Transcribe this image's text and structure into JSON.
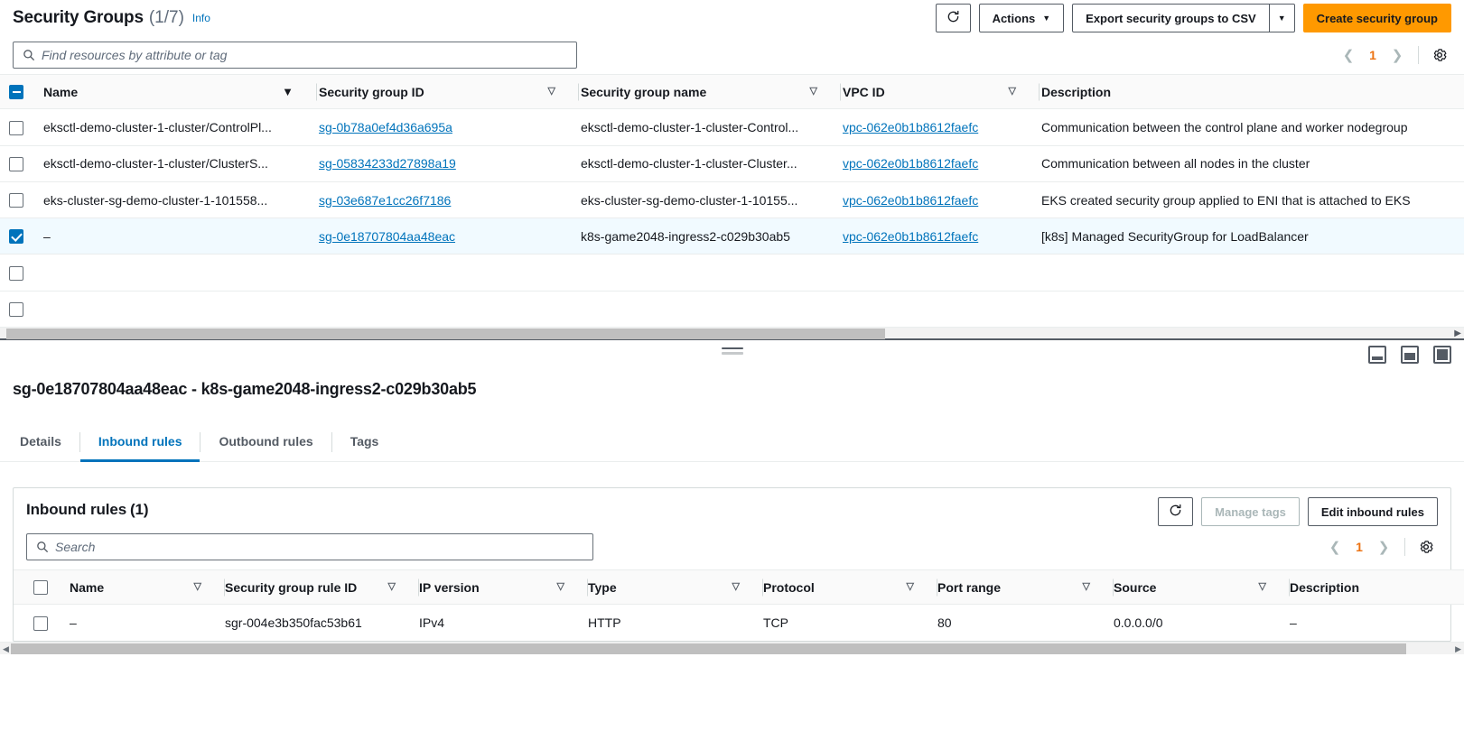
{
  "header": {
    "title": "Security Groups",
    "count": "(1/7)",
    "info_label": "Info",
    "refresh_icon": "refresh-icon",
    "actions_label": "Actions",
    "export_label": "Export security groups to CSV",
    "export_caret_icon": "chevron-down-icon",
    "create_label": "Create security group"
  },
  "search": {
    "placeholder": "Find resources by attribute or tag",
    "value": "",
    "icon": "search-icon"
  },
  "pagination": {
    "prev_icon": "chevron-left-icon",
    "page": "1",
    "next_icon": "chevron-right-icon",
    "settings_icon": "gear-icon"
  },
  "table": {
    "columns": [
      {
        "label": "Name",
        "sort_icon": "sort-descending-icon",
        "active": true
      },
      {
        "label": "Security group ID",
        "sort_icon": "sort-icon",
        "active": false
      },
      {
        "label": "Security group name",
        "sort_icon": "sort-icon",
        "active": false
      },
      {
        "label": "VPC ID",
        "sort_icon": "sort-icon",
        "active": false
      },
      {
        "label": "Description",
        "sort_icon": "",
        "active": false
      }
    ],
    "rows": [
      {
        "selected": false,
        "name": "eksctl-demo-cluster-1-cluster/ControlPl...",
        "sg_id": "sg-0b78a0ef4d36a695a",
        "sg_name": "eksctl-demo-cluster-1-cluster-Control...",
        "vpc_id": "vpc-062e0b1b8612faefc",
        "description": "Communication between the control plane and worker nodegroup"
      },
      {
        "selected": false,
        "name": "eksctl-demo-cluster-1-cluster/ClusterS...",
        "sg_id": "sg-05834233d27898a19",
        "sg_name": "eksctl-demo-cluster-1-cluster-Cluster...",
        "vpc_id": "vpc-062e0b1b8612faefc",
        "description": "Communication between all nodes in the cluster"
      },
      {
        "selected": false,
        "name": "eks-cluster-sg-demo-cluster-1-101558...",
        "sg_id": "sg-03e687e1cc26f7186",
        "sg_name": "eks-cluster-sg-demo-cluster-1-10155...",
        "vpc_id": "vpc-062e0b1b8612faefc",
        "description": "EKS created security group applied to ENI that is attached to EKS"
      },
      {
        "selected": true,
        "name": "–",
        "sg_id": "sg-0e18707804aa48eac",
        "sg_name": "k8s-game2048-ingress2-c029b30ab5",
        "vpc_id": "vpc-062e0b1b8612faefc",
        "description": "[k8s] Managed SecurityGroup for LoadBalancer"
      },
      {
        "selected": false,
        "name": "",
        "sg_id": "",
        "sg_name": "",
        "vpc_id": "",
        "description": ""
      },
      {
        "selected": false,
        "name": "",
        "sg_id": "",
        "sg_name": "",
        "vpc_id": "",
        "description": ""
      }
    ]
  },
  "split_panel": {
    "drag_handle_icon": "drag-handle-icon",
    "size_icons": [
      "panel-size-small-icon",
      "panel-size-medium-icon",
      "panel-size-large-icon"
    ],
    "title": "sg-0e18707804aa48eac - k8s-game2048-ingress2-c029b30ab5",
    "tabs": [
      {
        "label": "Details",
        "active": false
      },
      {
        "label": "Inbound rules",
        "active": true
      },
      {
        "label": "Outbound rules",
        "active": false
      },
      {
        "label": "Tags",
        "active": false
      }
    ]
  },
  "inbound_card": {
    "title": "Inbound rules",
    "count": "(1)",
    "refresh_icon": "refresh-icon",
    "manage_tags_label": "Manage tags",
    "manage_tags_disabled": true,
    "edit_label": "Edit inbound rules",
    "search": {
      "placeholder": "Search",
      "value": "",
      "icon": "search-icon"
    },
    "pagination": {
      "prev_icon": "chevron-left-icon",
      "page": "1",
      "next_icon": "chevron-right-icon",
      "settings_icon": "gear-icon"
    },
    "columns": [
      {
        "label": "Name",
        "sort_icon": "sort-icon"
      },
      {
        "label": "Security group rule ID",
        "sort_icon": "sort-icon"
      },
      {
        "label": "IP version",
        "sort_icon": "sort-icon"
      },
      {
        "label": "Type",
        "sort_icon": "sort-icon"
      },
      {
        "label": "Protocol",
        "sort_icon": "sort-icon"
      },
      {
        "label": "Port range",
        "sort_icon": "sort-icon"
      },
      {
        "label": "Source",
        "sort_icon": "sort-icon"
      },
      {
        "label": "Description",
        "sort_icon": ""
      }
    ],
    "rows": [
      {
        "name": "–",
        "rule_id": "sgr-004e3b350fac53b61",
        "ip_version": "IPv4",
        "type": "HTTP",
        "protocol": "TCP",
        "port_range": "80",
        "source": "0.0.0.0/0",
        "description": "–"
      }
    ]
  },
  "colors": {
    "accent_orange": "#ff9900",
    "link_blue": "#0073bb",
    "selected_row_bg": "#f1faff",
    "page_number": "#ec7211"
  }
}
